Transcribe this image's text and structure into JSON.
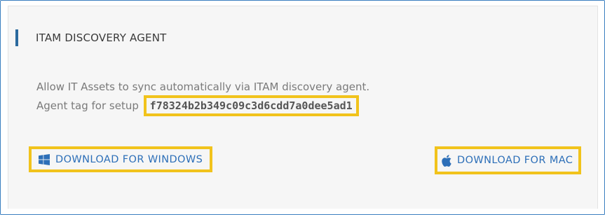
{
  "agent": {
    "title": "ITAM DISCOVERY AGENT",
    "description": "Allow IT Assets to sync automatically via ITAM discovery agent.",
    "tag_label": "Agent tag for setup",
    "tag_value": "f78324b2b349c09c3d6cdd7a0dee5ad1"
  },
  "downloads": {
    "windows": {
      "label": "DOWNLOAD FOR WINDOWS",
      "icon": "windows-icon"
    },
    "mac": {
      "label": "DOWNLOAD FOR MAC",
      "icon": "apple-icon"
    }
  },
  "colors": {
    "accent": "#2b6a9e",
    "link": "#2d6fb8",
    "highlight": "#f1c31c",
    "frame": "#3a7fc0"
  }
}
